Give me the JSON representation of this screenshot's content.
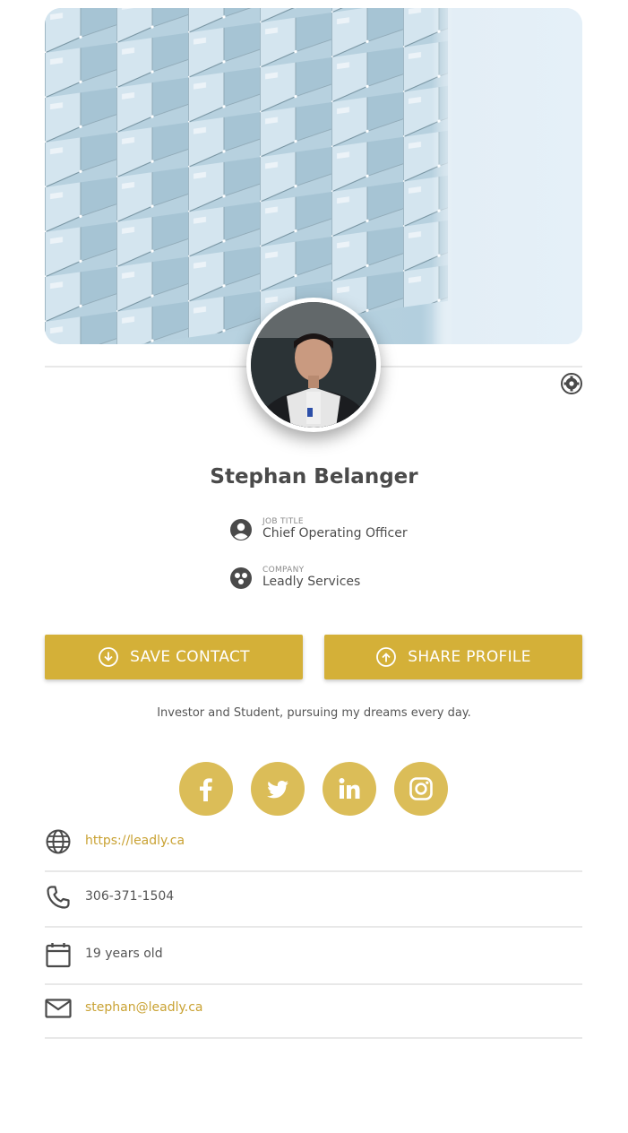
{
  "profile": {
    "name": "Stephan Belanger",
    "job_title_label": "JOB TITLE",
    "job_title": "Chief Operating Officer",
    "company_label": "COMPANY",
    "company": "Leadly Services",
    "bio": "Investor and Student, pursuing my dreams every day."
  },
  "actions": {
    "save_label": "SAVE CONTACT",
    "share_label": "SHARE PROFILE"
  },
  "socials": [
    {
      "name": "facebook-icon"
    },
    {
      "name": "twitter-icon"
    },
    {
      "name": "linkedin-icon"
    },
    {
      "name": "instagram-icon"
    }
  ],
  "contacts": {
    "website": "https://leadly.ca",
    "phone": "306-371-1504",
    "age": "19 years old",
    "email": "stephan@leadly.ca"
  },
  "colors": {
    "accent": "#d4b038",
    "social_bg": "#dbbd58",
    "link": "#c9a233",
    "icon": "#4a4a4a"
  },
  "icons": {
    "settings": "gear-icon",
    "job": "account-circle-icon",
    "company": "company-icon",
    "save": "download-circle-icon",
    "share": "upload-circle-icon",
    "website": "globe-icon",
    "phone": "phone-icon",
    "age": "calendar-icon",
    "email": "mail-icon"
  }
}
